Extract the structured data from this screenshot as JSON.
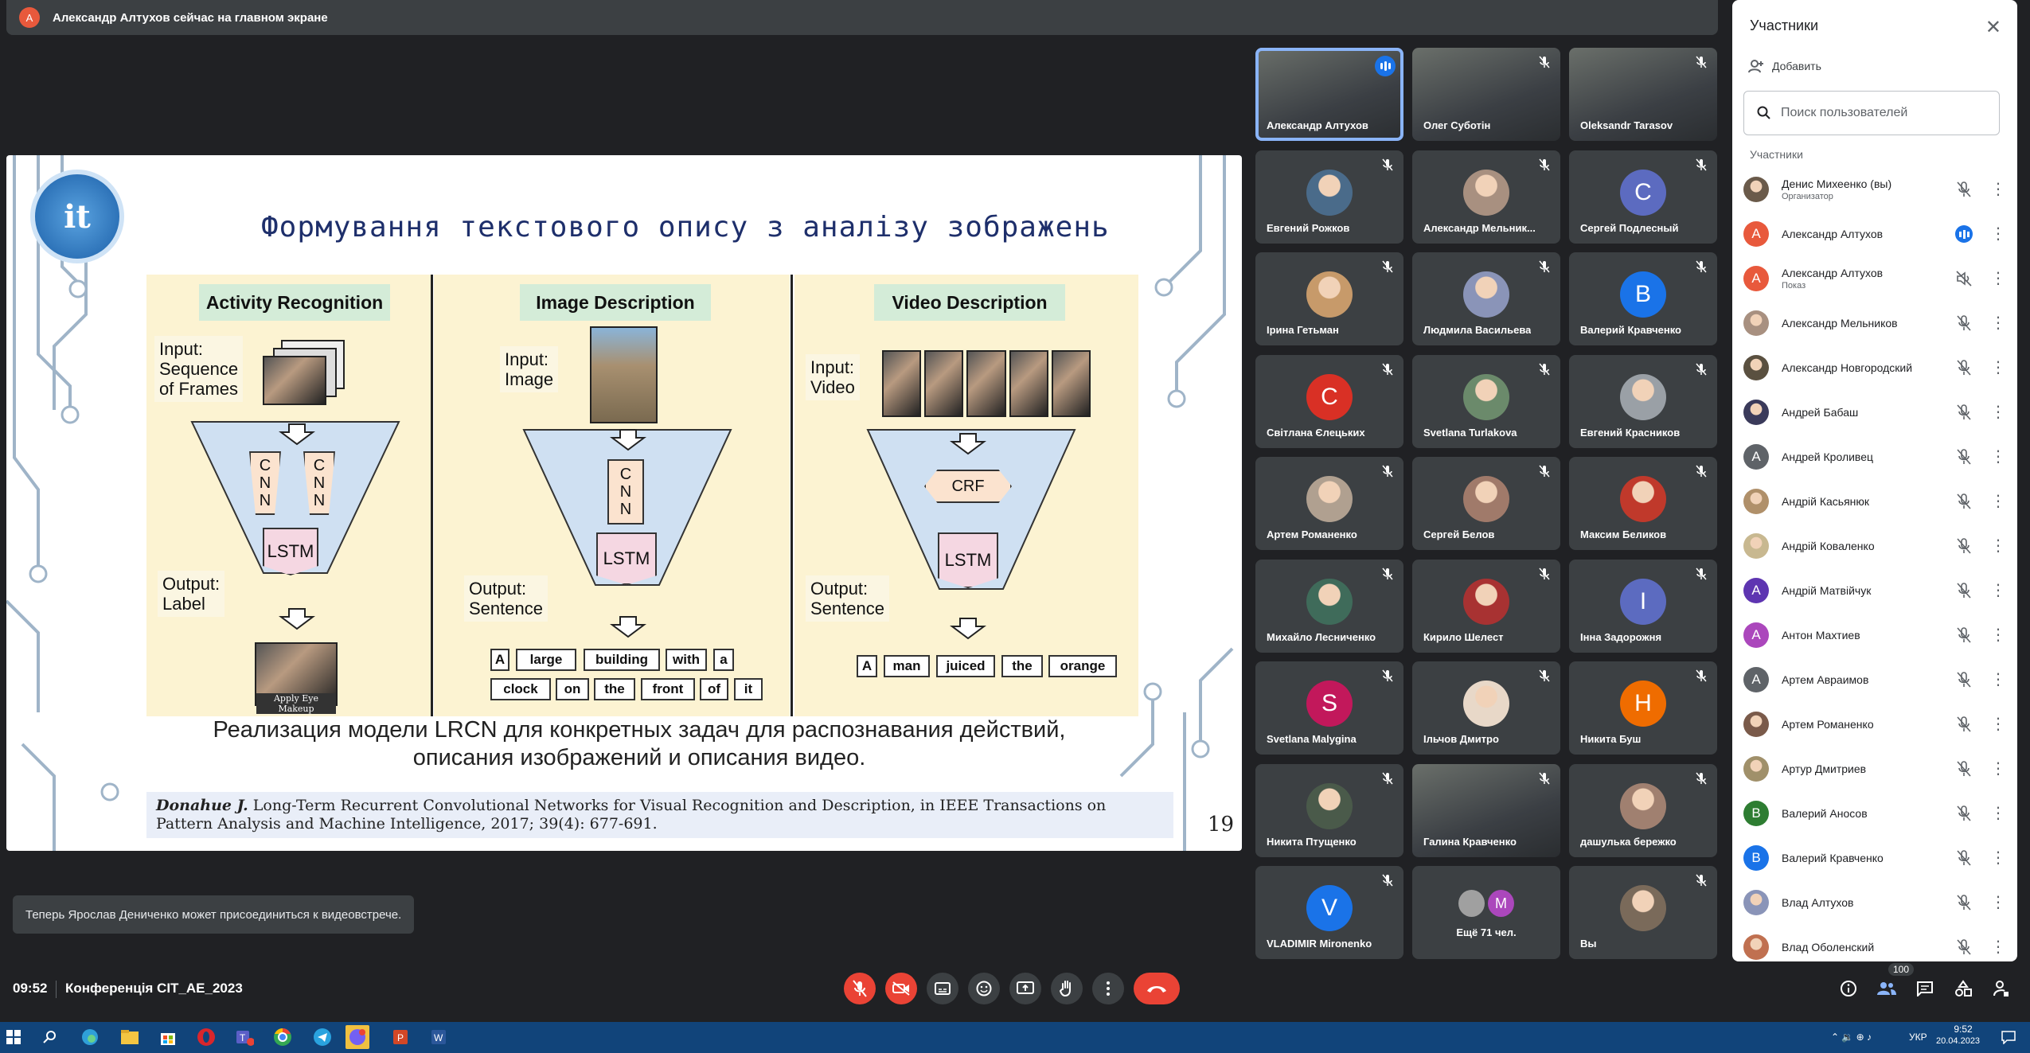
{
  "banner": {
    "avatar_letter": "А",
    "text": "Александр Алтухов сейчас на главном экране"
  },
  "slide": {
    "logo": "it",
    "title": "Формування текстового опису з аналізу зображень",
    "panels": [
      {
        "header": "Activity Recognition",
        "input": "Input:\nSequence\nof Frames",
        "output": "Output:\nLabel",
        "img_caption": "Apply Eye Makeup"
      },
      {
        "header": "Image Description",
        "input": "Input:\nImage",
        "output": "Output:\nSentence",
        "words_row1": [
          "A",
          "large",
          "building",
          "with",
          "a"
        ],
        "words_row2": [
          "clock",
          "on",
          "the",
          "front",
          "of",
          "it"
        ]
      },
      {
        "header": "Video Description",
        "input": "Input:\nVideo",
        "output": "Output:\nSentence",
        "words": [
          "A",
          "man",
          "juiced",
          "the",
          "orange"
        ]
      }
    ],
    "cnn_letters": [
      "C",
      "N",
      "N"
    ],
    "lstm": "LSTM",
    "crf": "CRF",
    "caption": "Реализация модели LRCN для конкретных задач для распознавания действий, описания изображений и описания видео.",
    "citation_author": "Donahue J.",
    "citation_text": " Long-Term Recurrent Convolutional Networks for Visual Recognition and Description, in IEEE Transactions on Pattern Analysis and Machine Intelligence, 2017; 39(4): 677-691.",
    "page_number": "19"
  },
  "tiles": [
    {
      "name": "Александр Алтухов",
      "type": "video",
      "active": true
    },
    {
      "name": "Олег Суботін",
      "type": "video"
    },
    {
      "name": "Oleksandr Tarasov",
      "type": "video"
    },
    {
      "name": "Евгений Рожков",
      "type": "photo",
      "color": "#4a6b8a"
    },
    {
      "name": "Александр Мельник...",
      "type": "photo",
      "color": "#a89080"
    },
    {
      "name": "Сергей Подлесный",
      "type": "letter",
      "letter": "C",
      "color": "#5c6bc0"
    },
    {
      "name": "Ірина Гетьман",
      "type": "photo",
      "color": "#c79a6a"
    },
    {
      "name": "Людмила Васильева",
      "type": "photo",
      "color": "#8a94b8"
    },
    {
      "name": "Валерий Кравченко",
      "type": "letter",
      "letter": "B",
      "color": "#1a73e8"
    },
    {
      "name": "Світлана Єлецьких",
      "type": "letter",
      "letter": "C",
      "color": "#d93025"
    },
    {
      "name": "Svetlana Turlakova",
      "type": "photo",
      "color": "#6b8a6b"
    },
    {
      "name": "Евгений Красников",
      "type": "photo",
      "color": "#9aa0a6"
    },
    {
      "name": "Артем Романенко",
      "type": "photo",
      "color": "#b0a090"
    },
    {
      "name": "Сергей Белов",
      "type": "photo",
      "color": "#a07a6a"
    },
    {
      "name": "Максим Беликов",
      "type": "photo",
      "color": "#c0392b"
    },
    {
      "name": "Михайло Лесниченко",
      "type": "photo",
      "color": "#3f6b5a"
    },
    {
      "name": "Кирило Шелест",
      "type": "photo",
      "color": "#a83232"
    },
    {
      "name": "Інна Задорожня",
      "type": "letter",
      "letter": "I",
      "color": "#5c6bc0"
    },
    {
      "name": "Svetlana Malygina",
      "type": "letter",
      "letter": "S",
      "color": "#c2185b"
    },
    {
      "name": "Ільчов Дмитро",
      "type": "photo",
      "color": "#e8d8c8"
    },
    {
      "name": "Никита Буш",
      "type": "letter",
      "letter": "H",
      "color": "#ef6c00"
    },
    {
      "name": "Никита Птущенко",
      "type": "photo",
      "color": "#4a5a4a"
    },
    {
      "name": "Галина Кравченко",
      "type": "video"
    },
    {
      "name": "дашулька бережко",
      "type": "photo",
      "color": "#a08070"
    },
    {
      "name": "VLADIMIR Mironenko",
      "type": "letter",
      "letter": "V",
      "color": "#1a73e8"
    },
    {
      "name": "Ещё 71 чел.",
      "type": "more",
      "letter": "M"
    },
    {
      "name": "Вы",
      "type": "photo",
      "color": "#7a6a5a"
    }
  ],
  "sidebar": {
    "title": "Участники",
    "add_label": "Добавить",
    "search_placeholder": "Поиск пользователей",
    "section_label": "Участники",
    "participants": [
      {
        "name": "Денис Михеенко (вы)",
        "sub": "Организатор",
        "avatar": "photo",
        "color": "#6a5a4a"
      },
      {
        "name": "Александр Алтухов",
        "avatar": "letter",
        "letter": "А",
        "color": "#e8593c",
        "speaking": true
      },
      {
        "name": "Александр Алтухов",
        "sub": "Показ",
        "avatar": "letter",
        "letter": "А",
        "color": "#e8593c",
        "presenting": true
      },
      {
        "name": "Александр Мельников",
        "avatar": "photo",
        "color": "#a89080"
      },
      {
        "name": "Александр Новгородский",
        "avatar": "photo",
        "color": "#5a5040"
      },
      {
        "name": "Андрей Бабаш",
        "avatar": "photo",
        "color": "#3a3a5a"
      },
      {
        "name": "Андрей Кроливец",
        "avatar": "letter",
        "letter": "А",
        "color": "#5f6368"
      },
      {
        "name": "Андрій Касьянюк",
        "avatar": "photo",
        "color": "#b0906a"
      },
      {
        "name": "Андрій Коваленко",
        "avatar": "photo",
        "color": "#c8b890"
      },
      {
        "name": "Андрій Матвійчук",
        "avatar": "letter",
        "letter": "А",
        "color": "#5e35b1"
      },
      {
        "name": "Антон Махтиев",
        "avatar": "letter",
        "letter": "А",
        "color": "#ab47bc"
      },
      {
        "name": "Артем Авраимов",
        "avatar": "letter",
        "letter": "А",
        "color": "#5f6368"
      },
      {
        "name": "Артем Романенко",
        "avatar": "photo",
        "color": "#7a5a4a"
      },
      {
        "name": "Артур Дмитриев",
        "avatar": "photo",
        "color": "#a0906a"
      },
      {
        "name": "Валерий Аносов",
        "avatar": "letter",
        "letter": "В",
        "color": "#2e7d32"
      },
      {
        "name": "Валерий Кравченко",
        "avatar": "letter",
        "letter": "В",
        "color": "#1a73e8"
      },
      {
        "name": "Влад Алтухов",
        "avatar": "photo",
        "color": "#8a94b8"
      },
      {
        "name": "Влад Оболенский",
        "avatar": "photo",
        "color": "#c07050"
      }
    ]
  },
  "toast": "Теперь Ярослав Дениченко может присоединиться к видеовстрече.",
  "bottom": {
    "time": "09:52",
    "meeting": "Конференція CIT_AE_2023",
    "participants_badge": "100"
  },
  "taskbar": {
    "lang": "УКР",
    "time": "9:52",
    "date": "20.04.2023"
  },
  "colors": {
    "bg": "#202124",
    "end_call": "#ea4335",
    "accent": "#1a73e8"
  }
}
